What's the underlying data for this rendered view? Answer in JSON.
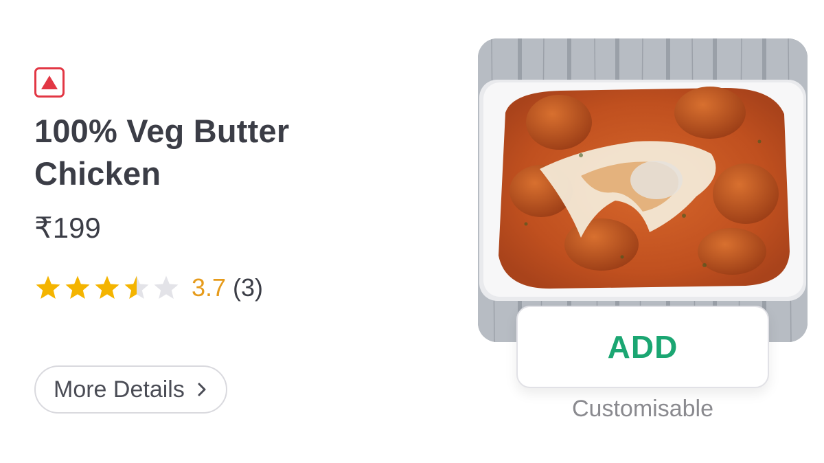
{
  "item": {
    "diet_marker_icon": "non-veg-triangle-icon",
    "diet_marker_color": "#e23744",
    "name": "100% Veg Butter Chicken",
    "price": "₹199",
    "rating": {
      "stars_filled": 3.5,
      "stars_total": 5,
      "value": "3.7",
      "count": "(3)",
      "star_color": "#f4b400",
      "empty_star_color": "#e3e3e8",
      "value_color": "#e69b1b"
    },
    "more_details_label": "More Details",
    "image_icon": "butter-chicken-photo"
  },
  "cta": {
    "add_label": "ADD",
    "add_color": "#1ba672",
    "customisable_label": "Customisable"
  }
}
